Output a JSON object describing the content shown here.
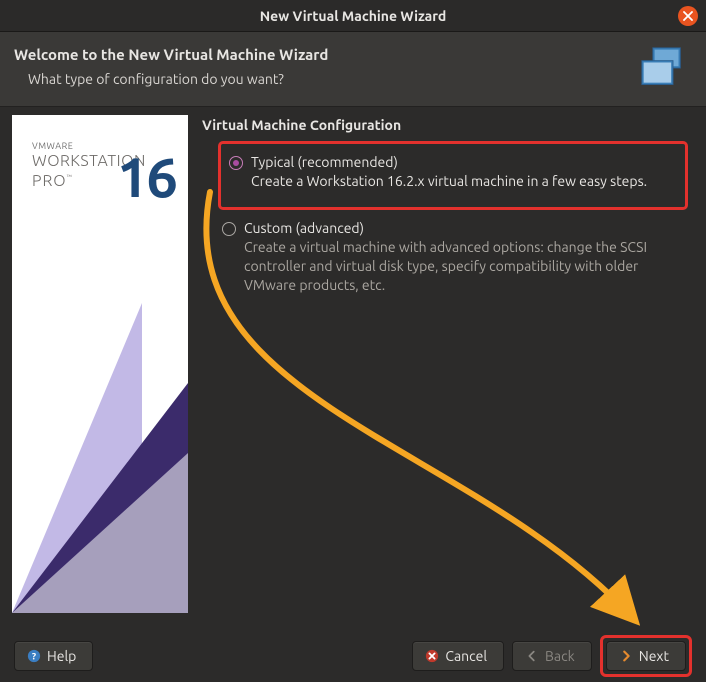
{
  "window": {
    "title": "New Virtual Machine Wizard"
  },
  "header": {
    "heading": "Welcome to the New Virtual Machine Wizard",
    "question": "What type of configuration do you want?"
  },
  "sidebar": {
    "brand_small": "VMWARE",
    "brand_main": "WORKSTATION",
    "brand_sub": "PRO",
    "version": "16"
  },
  "config": {
    "section_title": "Virtual Machine Configuration",
    "options": [
      {
        "label": "Typical (recommended)",
        "desc": "Create a Workstation 16.2.x virtual machine in a few easy steps.",
        "selected": true
      },
      {
        "label": "Custom (advanced)",
        "desc": "Create a virtual machine with advanced options: change the SCSI controller and virtual disk type, specify compatibility with older VMware products, etc.",
        "selected": false
      }
    ]
  },
  "buttons": {
    "help": "Help",
    "cancel": "Cancel",
    "back": "Back",
    "next": "Next"
  }
}
